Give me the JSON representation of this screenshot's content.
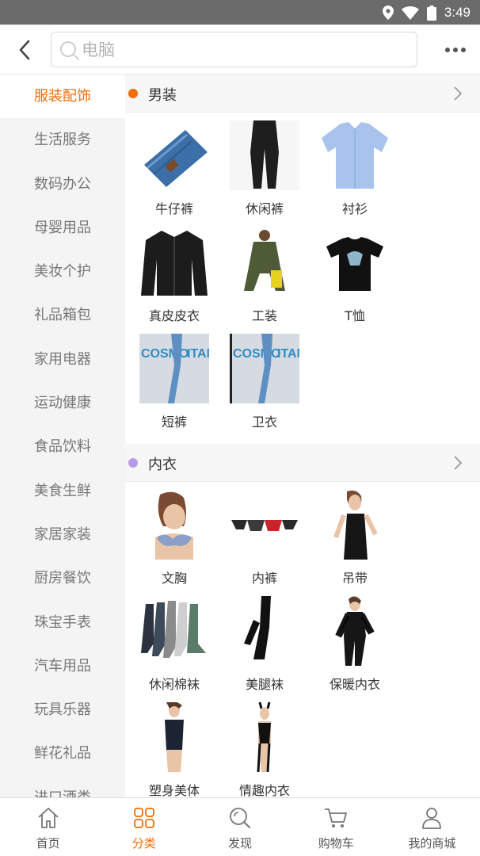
{
  "status_bar": {
    "time": "3:49",
    "icons": [
      "location-icon",
      "wifi-icon",
      "battery-icon"
    ]
  },
  "header": {
    "search_placeholder": "电脑"
  },
  "sidebar": {
    "items": [
      {
        "label": "服装配饰",
        "active": true
      },
      {
        "label": "生活服务"
      },
      {
        "label": "数码办公"
      },
      {
        "label": "母婴用品"
      },
      {
        "label": "美妆个护"
      },
      {
        "label": "礼品箱包"
      },
      {
        "label": "家用电器"
      },
      {
        "label": "运动健康"
      },
      {
        "label": "食品饮料"
      },
      {
        "label": "美食生鲜"
      },
      {
        "label": "家居家装"
      },
      {
        "label": "厨房餐饮"
      },
      {
        "label": "珠宝手表"
      },
      {
        "label": "汽车用品"
      },
      {
        "label": "玩具乐器"
      },
      {
        "label": "鲜花礼品"
      },
      {
        "label": "进口酒类"
      }
    ]
  },
  "sections": [
    {
      "title": "男装",
      "dot_color": "#f46c06",
      "items": [
        {
          "label": "牛仔裤",
          "icon": "jeans-image"
        },
        {
          "label": "休闲裤",
          "icon": "casual-pants-image"
        },
        {
          "label": "衬衫",
          "icon": "shirt-image"
        },
        {
          "label": "真皮皮衣",
          "icon": "leather-jacket-image"
        },
        {
          "label": "工装",
          "icon": "workwear-image"
        },
        {
          "label": "T恤",
          "icon": "tshirt-image"
        },
        {
          "label": "短裤",
          "icon": "shorts-image"
        },
        {
          "label": "卫衣",
          "icon": "hoodie-image"
        }
      ]
    },
    {
      "title": "内衣",
      "dot_color": "#b79be8",
      "items": [
        {
          "label": "文胸",
          "icon": "bra-image"
        },
        {
          "label": "内裤",
          "icon": "underwear-image"
        },
        {
          "label": "吊带",
          "icon": "camisole-image"
        },
        {
          "label": "休闲棉袜",
          "icon": "socks-image"
        },
        {
          "label": "美腿袜",
          "icon": "stockings-image"
        },
        {
          "label": "保暖内衣",
          "icon": "thermal-underwear-image"
        },
        {
          "label": "塑身美体",
          "icon": "shapewear-image"
        },
        {
          "label": "情趣内衣",
          "icon": "lingerie-image"
        }
      ]
    }
  ],
  "tabbar": {
    "tabs": [
      {
        "label": "首页",
        "icon": "home-icon"
      },
      {
        "label": "分类",
        "icon": "category-icon",
        "active": true
      },
      {
        "label": "发现",
        "icon": "discover-icon"
      },
      {
        "label": "购物车",
        "icon": "cart-icon"
      },
      {
        "label": "我的商城",
        "icon": "profile-icon"
      }
    ]
  },
  "colors": {
    "accent": "#f46c06",
    "sidebar_bg": "#f4f4f4",
    "status_bar_bg": "#6b6b6b"
  }
}
